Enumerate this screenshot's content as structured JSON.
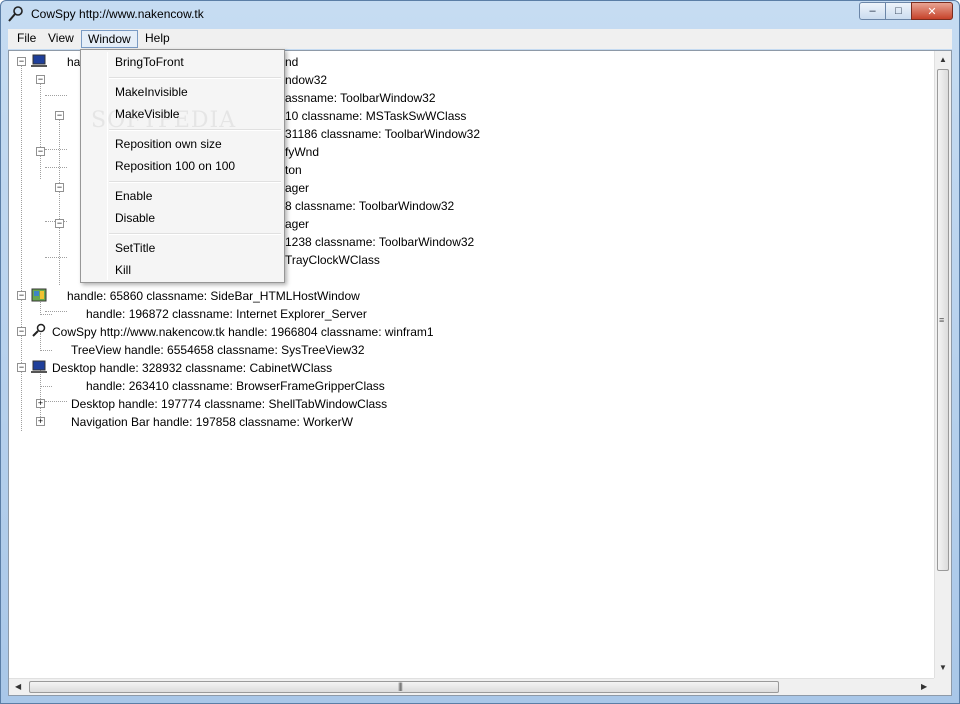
{
  "window": {
    "title": "CowSpy http://www.nakencow.tk"
  },
  "menubar": {
    "items": [
      "File",
      "View",
      "Window",
      "Help"
    ]
  },
  "window_menu": {
    "items": [
      "BringToFront",
      "MakeInvisible",
      "MakeVisible",
      "Reposition own size",
      "Reposition 100 on 100",
      "Enable",
      "Disable",
      "SetTitle",
      "Kill"
    ],
    "watermark": "SOFTPEDIA"
  },
  "tree": {
    "partial_rows": [
      "ha",
      "nd",
      "ndow32",
      "assname: ToolbarWindow32",
      "10     classname: MSTaskSwWClass",
      "31186     classname: ToolbarWindow32",
      "fyWnd",
      "ton",
      "ager",
      "8     classname: ToolbarWindow32",
      "ager",
      "1238     classname: ToolbarWindow32",
      "TrayClockWClass"
    ],
    "rows": [
      "handle: 65860     classname: SideBar_HTMLHostWindow",
      "handle: 196872     classname: Internet Explorer_Server",
      "CowSpy http://www.nakencow.tk     handle: 1966804     classname: winfram1",
      "TreeView     handle: 6554658     classname: SysTreeView32",
      "Desktop     handle: 328932     classname: CabinetWClass",
      "handle: 263410     classname: BrowserFrameGripperClass",
      "Desktop     handle: 197774     classname: ShellTabWindowClass",
      "Navigation Bar     handle: 197858     classname: WorkerW"
    ]
  },
  "colors": {
    "titlebar": "#b9d3ee",
    "menu_highlight": "#e5eef8",
    "close_button": "#c6422a"
  },
  "icons": {
    "app": "magnifier-icon",
    "computer": "computer-icon",
    "sidebar": "sidebar-window-icon"
  }
}
